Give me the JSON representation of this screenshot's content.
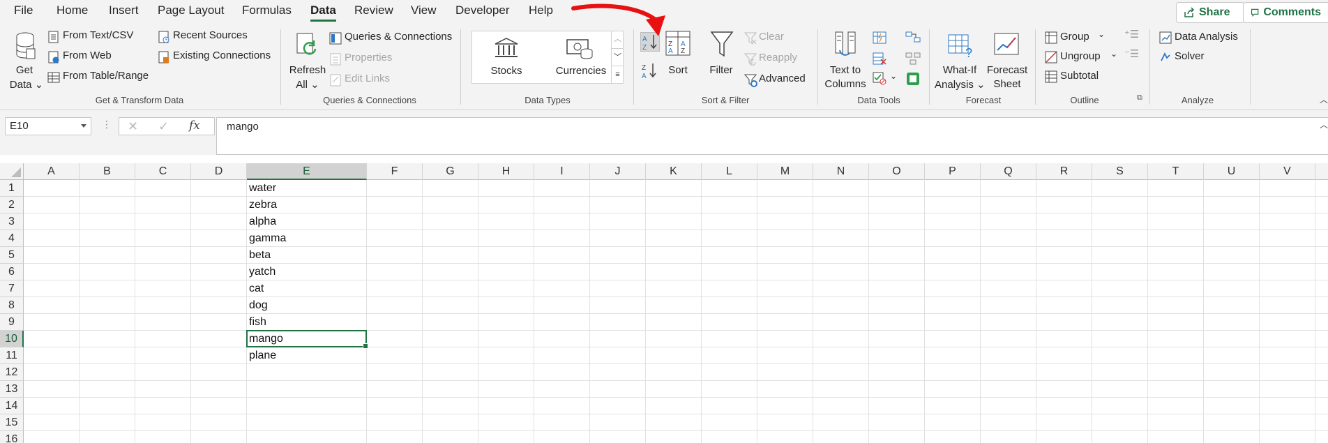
{
  "tabs": [
    "File",
    "Home",
    "Insert",
    "Page Layout",
    "Formulas",
    "Data",
    "Review",
    "View",
    "Developer",
    "Help"
  ],
  "active_tab": "Data",
  "share_label": "Share",
  "comments_label": "Comments",
  "ribbon": {
    "get_transform": {
      "get_data": [
        "Get",
        "Data"
      ],
      "from_text": "From Text/CSV",
      "from_web": "From Web",
      "from_table": "From Table/Range",
      "recent_sources": "Recent Sources",
      "existing_connections": "Existing Connections",
      "label": "Get & Transform Data"
    },
    "queries": {
      "refresh": [
        "Refresh",
        "All"
      ],
      "queries_connections": "Queries & Connections",
      "properties": "Properties",
      "edit_links": "Edit Links",
      "label": "Queries & Connections"
    },
    "data_types": {
      "stocks": "Stocks",
      "currencies": "Currencies",
      "label": "Data Types"
    },
    "sort_filter": {
      "sort": "Sort",
      "filter": "Filter",
      "clear": "Clear",
      "reapply": "Reapply",
      "advanced": "Advanced",
      "label": "Sort & Filter"
    },
    "data_tools": {
      "text_to_columns": [
        "Text to",
        "Columns"
      ],
      "label": "Data Tools"
    },
    "forecast": {
      "what_if": [
        "What-If",
        "Analysis"
      ],
      "forecast_sheet": [
        "Forecast",
        "Sheet"
      ],
      "label": "Forecast"
    },
    "outline": {
      "group": "Group",
      "ungroup": "Ungroup",
      "subtotal": "Subtotal",
      "label": "Outline"
    },
    "analyze": {
      "data_analysis": "Data Analysis",
      "solver": "Solver",
      "label": "Analyze"
    }
  },
  "name_box": "E10",
  "formula_value": "mango",
  "columns": [
    "A",
    "B",
    "C",
    "D",
    "E",
    "F",
    "G",
    "H",
    "I",
    "J",
    "K",
    "L",
    "M",
    "N",
    "O",
    "P",
    "Q",
    "R",
    "S",
    "T",
    "U",
    "V"
  ],
  "rows": [
    "1",
    "2",
    "3",
    "4",
    "5",
    "6",
    "7",
    "8",
    "9",
    "10",
    "11",
    "12",
    "13",
    "14",
    "15",
    "16"
  ],
  "selected_cell": {
    "col": "E",
    "row": "10"
  },
  "column_e": [
    "water",
    "zebra",
    "alpha",
    "gamma",
    "beta",
    "yatch",
    "cat",
    "dog",
    "fish",
    "mango",
    "plane"
  ],
  "colors": {
    "accent": "#217346",
    "arrow": "#e81010"
  }
}
